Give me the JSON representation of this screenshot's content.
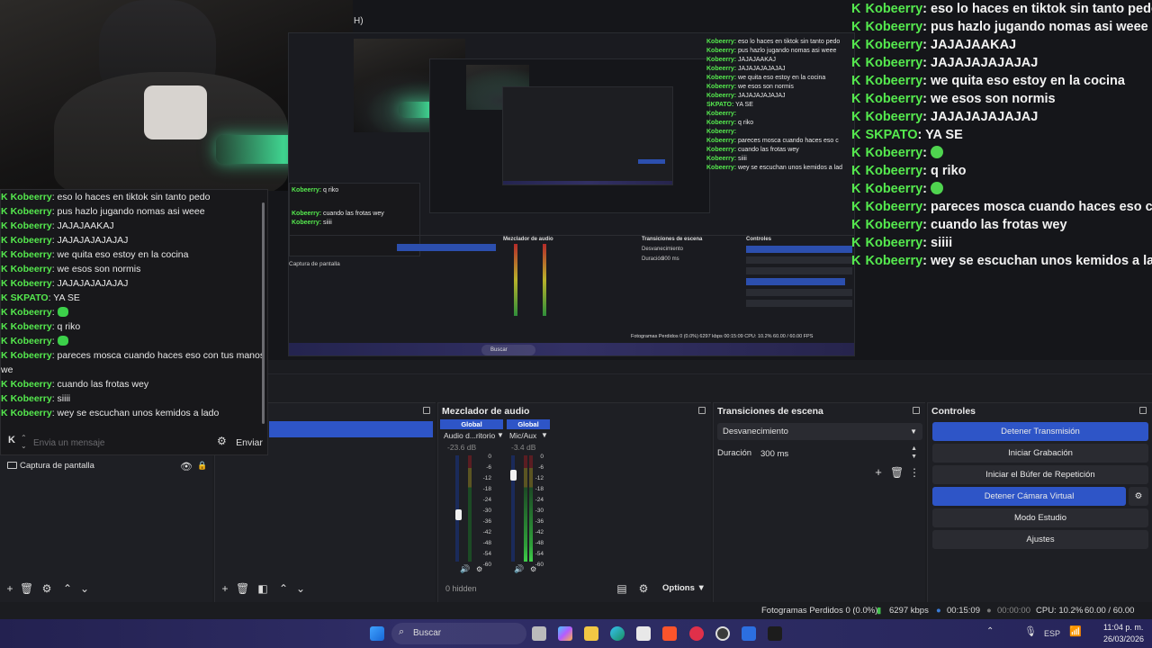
{
  "preview": {
    "mini_header_fragment": "H)",
    "mini_obs": {
      "chat_lines": [
        {
          "user": "Kobeerry",
          "text": "eso lo haces en tiktok sin tanto pedo"
        },
        {
          "user": "Kobeerry",
          "text": "pus hazlo jugando nomas asi weee"
        },
        {
          "user": "Kobeerry",
          "text": "JAJAJAAKAJ"
        },
        {
          "user": "Kobeerry",
          "text": "JAJAJAJAJAJAJ"
        },
        {
          "user": "Kobeerry",
          "text": "we quita eso estoy en la cocina"
        },
        {
          "user": "Kobeerry",
          "text": "we esos son normis"
        },
        {
          "user": "Kobeerry",
          "text": "JAJAJAJAJAJAJ"
        },
        {
          "user": "SKPATO",
          "text": "YA SE"
        },
        {
          "user": "Kobeerry",
          "text": ""
        },
        {
          "user": "Kobeerry",
          "text": "q riko"
        },
        {
          "user": "Kobeerry",
          "text": ""
        },
        {
          "user": "Kobeerry",
          "text": "pareces mosca cuando haces eso c"
        },
        {
          "user": "Kobeerry",
          "text": "cuando las frotas wey"
        },
        {
          "user": "Kobeerry",
          "text": "siiii"
        },
        {
          "user": "Kobeerry",
          "text": "wey se escuchan unos kemidos a lad"
        }
      ],
      "panel_titles": {
        "mixer": "Mezclador de audio",
        "transitions": "Transiciones de escena",
        "controls": "Controles"
      },
      "transition_value": "Desvanecimiento",
      "duration_label": "Duración",
      "duration_value": "300 ms",
      "control_buttons": [
        "Detener Transmisión",
        "Iniciar Grabación",
        "Iniciar el Búfer de Repetición",
        "Detener Cámara Virtual",
        "Modo Estudio",
        "Ajustes"
      ],
      "source_item": "Captura de pantalla",
      "status": "Fotogramas Perdidos 0 (0.0%)   6297 kbps   00:15:09   CPU: 10.2%   60.00 / 60.00 FPS",
      "search": "Buscar"
    },
    "big_chat": [
      {
        "user": "Kobeerry",
        "text": "eso lo haces en tiktok sin tanto pedo",
        "emote": false
      },
      {
        "user": "Kobeerry",
        "text": "pus hazlo jugando nomas asi weee",
        "emote": false
      },
      {
        "user": "Kobeerry",
        "text": "JAJAJAAKAJ",
        "emote": false
      },
      {
        "user": "Kobeerry",
        "text": "JAJAJAJAJAJAJ",
        "emote": false
      },
      {
        "user": "Kobeerry",
        "text": "we quita eso estoy en la cocina",
        "emote": false
      },
      {
        "user": "Kobeerry",
        "text": "we esos son normis",
        "emote": false
      },
      {
        "user": "Kobeerry",
        "text": "JAJAJAJAJAJAJ",
        "emote": false
      },
      {
        "user": "SKPATO",
        "text": "YA SE",
        "emote": false
      },
      {
        "user": "Kobeerry",
        "text": "",
        "emote": true
      },
      {
        "user": "Kobeerry",
        "text": "q riko",
        "emote": false
      },
      {
        "user": "Kobeerry",
        "text": "",
        "emote": true
      },
      {
        "user": "Kobeerry",
        "text": "pareces mosca cuando haces eso c",
        "emote": false
      },
      {
        "user": "Kobeerry",
        "text": "cuando las frotas wey",
        "emote": false
      },
      {
        "user": "Kobeerry",
        "text": "siiii",
        "emote": false
      },
      {
        "user": "Kobeerry",
        "text": "wey se escuchan unos kemidos a lad",
        "emote": false
      }
    ]
  },
  "chat_window": {
    "messages": [
      {
        "user": "Kobeerry",
        "text": "eso lo haces en tiktok sin tanto pedo",
        "emote": false
      },
      {
        "user": "Kobeerry",
        "text": "pus hazlo jugando nomas asi weee",
        "emote": false
      },
      {
        "user": "Kobeerry",
        "text": "JAJAJAAKAJ",
        "emote": false
      },
      {
        "user": "Kobeerry",
        "text": "JAJAJAJAJAJAJ",
        "emote": false
      },
      {
        "user": "Kobeerry",
        "text": "we quita eso estoy en la cocina",
        "emote": false
      },
      {
        "user": "Kobeerry",
        "text": "we esos son normis",
        "emote": false
      },
      {
        "user": "Kobeerry",
        "text": "JAJAJAJAJAJAJ",
        "emote": false
      },
      {
        "user": "SKPATO",
        "text": "YA SE",
        "emote": false
      },
      {
        "user": "Kobeerry",
        "text": "",
        "emote": true
      },
      {
        "user": "Kobeerry",
        "text": "q riko",
        "emote": false
      },
      {
        "user": "Kobeerry",
        "text": "",
        "emote": true
      },
      {
        "user": "Kobeerry",
        "text": "pareces mosca cuando haces eso con tus manos",
        "emote": false
      },
      {
        "user": "",
        "text": "we",
        "emote": false
      },
      {
        "user": "Kobeerry",
        "text": "cuando las frotas wey",
        "emote": false
      },
      {
        "user": "Kobeerry",
        "text": "siiii",
        "emote": false
      },
      {
        "user": "Kobeerry",
        "text": "wey se escuchan unos kemidos a lado",
        "emote": false
      }
    ],
    "input_placeholder": "Envia un mensaje",
    "send_label": "Enviar",
    "kick_icon": "kick-logo-icon",
    "settings_icon": "gear-icon"
  },
  "sources": {
    "items": [
      {
        "label": "Captura de pantalla"
      }
    ]
  },
  "mixer": {
    "title": "Mezclador de audio",
    "channels": [
      {
        "global_label": "Global",
        "name": "Audio d...ritorio",
        "db": "-23.6 dB",
        "level": 0.19
      },
      {
        "global_label": "Global",
        "name": "Mic/Aux",
        "db": "-3.4 dB",
        "level": 0.84
      }
    ],
    "scale": [
      "0",
      "-6",
      "-12",
      "-18",
      "-24",
      "-30",
      "-36",
      "-42",
      "-48",
      "-54",
      "-60"
    ],
    "hidden_label": "0 hidden",
    "options_label": "Options"
  },
  "transitions": {
    "title": "Transiciones de escena",
    "selected": "Desvanecimiento",
    "duration_label": "Duración",
    "duration_value": "300 ms"
  },
  "controls": {
    "title": "Controles",
    "buttons": [
      {
        "label": "Detener Transmisión",
        "active": true
      },
      {
        "label": "Iniciar Grabación",
        "active": false
      },
      {
        "label": "Iniciar el Búfer de Repetición",
        "active": false
      },
      {
        "label": "Detener Cámara Virtual",
        "active": true
      },
      {
        "label": "Modo Estudio",
        "active": false
      },
      {
        "label": "Ajustes",
        "active": false
      }
    ]
  },
  "status": {
    "dropped_frames": "Fotogramas Perdidos 0 (0.0%)",
    "bitrate": "6297 kbps",
    "stream_time": "00:15:09",
    "record_time": "00:00:00",
    "cpu": "CPU: 10.2%",
    "fps": "60.00 / 60.00 FPS"
  },
  "taskbar": {
    "search_label": "Buscar",
    "language": "ESP",
    "time": "11:04 p. m.",
    "date": "26/03/2026"
  },
  "colors": {
    "accent_blue": "#2e55c7",
    "chat_green": "#55e94e",
    "panel_bg": "#1e1f24"
  }
}
